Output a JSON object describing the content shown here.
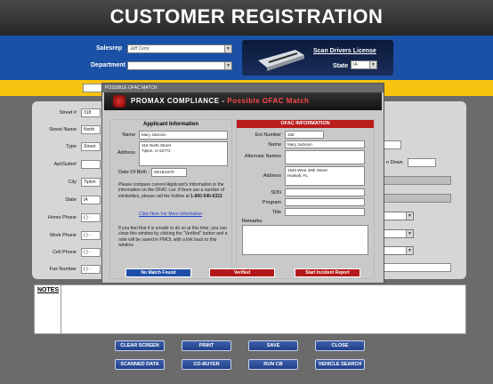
{
  "header": {
    "title": "CUSTOMER REGISTRATION"
  },
  "top_form": {
    "salesrep_label": "Salesrep",
    "salesrep_value": "Jeff Curry",
    "department_label": "Department",
    "department_value": "",
    "scan_link": "Scan Drivers License",
    "state_label": "State",
    "state_value": "IA"
  },
  "form": {
    "street_label": "Street #",
    "street_value": "318",
    "street_name_label": "Street Name",
    "street_name_value": "North",
    "type_label": "Type",
    "type_value": "Street",
    "apt_label": "Apt/Suite#",
    "city_label": "City",
    "city_value": "Tipton",
    "state_label": "State",
    "state_value": "IA",
    "home_phone_label": "Home Phone",
    "home_phone_value": "(   )   -",
    "work_phone_label": "Work Phone",
    "work_phone_value": "(   )   -",
    "cell_phone_label": "Cell Phone",
    "cell_phone_value": "(   )   -",
    "fax_label": "Fax Number",
    "fax_value": "(   )   -",
    "down_label": "n Down"
  },
  "notes": {
    "label": "NOTES"
  },
  "buttons": {
    "clear": "CLEAR SCREEN",
    "print": "PRINT",
    "save": "SAVE",
    "close": "CLOSE",
    "scanned": "SCANNED DATA",
    "cobuyer": "CO-BUYER",
    "runcb": "RUN CB",
    "vehicle": "VEHICLE SEARCH"
  },
  "dialog": {
    "window_title": "POSSIBLE OFAC MATCH",
    "title_main": "PROMAX COMPLIANCE - ",
    "title_red": "Possible OFAC Match",
    "applicant": {
      "heading": "Applicant Information",
      "name_label": "Name",
      "name_value": "Mary Jackson",
      "address_label": "Address",
      "address_line1": "318 North Street",
      "address_line2": "Tipton, IA 52772",
      "dob_label": "Date Of Birth :",
      "dob_value": "05/18/1979",
      "compare_text": "Please compare current Applicant's Information to the information on the OFAC List. If there are a number of similarities, please call the hotline at",
      "hotline": "1-800-540-6322",
      "more_info_link": "Click Here For More Information",
      "unsafe_text": "If you feel that it is unsafe to do so at this time, you can close this window by clicking the \"Verified\" button and a note will be saved in PMOL with a link back to this window."
    },
    "ofac": {
      "heading": "OFAC INFORMATION",
      "ent_label": "Ent Number",
      "ent_value": "166",
      "name_label": "Name",
      "name_value": "Mary Jackson",
      "alt_label": "Alternate Names",
      "address_label": "Address",
      "address_line1": "1640 West 49th Street",
      "address_line2": "Hialeah, FL",
      "sdn_label": "SDN",
      "program_label": "Program",
      "title_label": "Title",
      "remarks_label": "Remarks:"
    },
    "buttons": {
      "no_match": "No Match Found",
      "verified": "Verified",
      "incident": "Start Incident Report"
    },
    "colors": {
      "no_match": "#1f4ea8",
      "verified": "#b41818",
      "incident": "#b41818"
    }
  }
}
